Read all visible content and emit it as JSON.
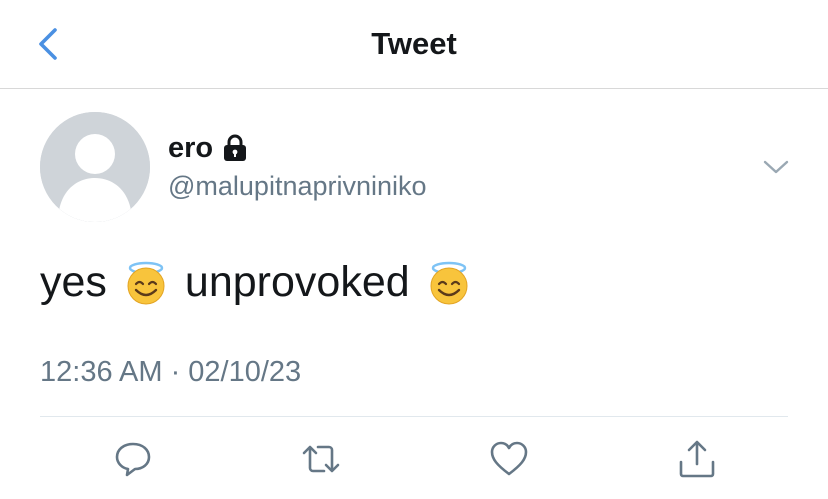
{
  "header": {
    "title": "Tweet",
    "back_icon": "chevron-left-icon",
    "accent_color": "#4a90e2"
  },
  "tweet": {
    "author": {
      "name": "ero",
      "handle": "@malupitnaprivniniko",
      "protected_icon": "lock-icon",
      "avatar_icon": "default-avatar-icon"
    },
    "text_parts": [
      "yes",
      "unprovoked"
    ],
    "emoji": "smiling-face-with-halo",
    "timestamp": "12:36 AM · 02/10/23",
    "more_icon": "chevron-down-icon"
  },
  "actions": [
    {
      "name": "reply",
      "icon": "reply-icon"
    },
    {
      "name": "retweet",
      "icon": "retweet-icon"
    },
    {
      "name": "like",
      "icon": "heart-icon"
    },
    {
      "name": "share",
      "icon": "share-icon"
    }
  ],
  "colors": {
    "text": "#14171a",
    "secondary": "#657786",
    "icon": "#657786",
    "avatar_bg": "#cfd4d9"
  }
}
